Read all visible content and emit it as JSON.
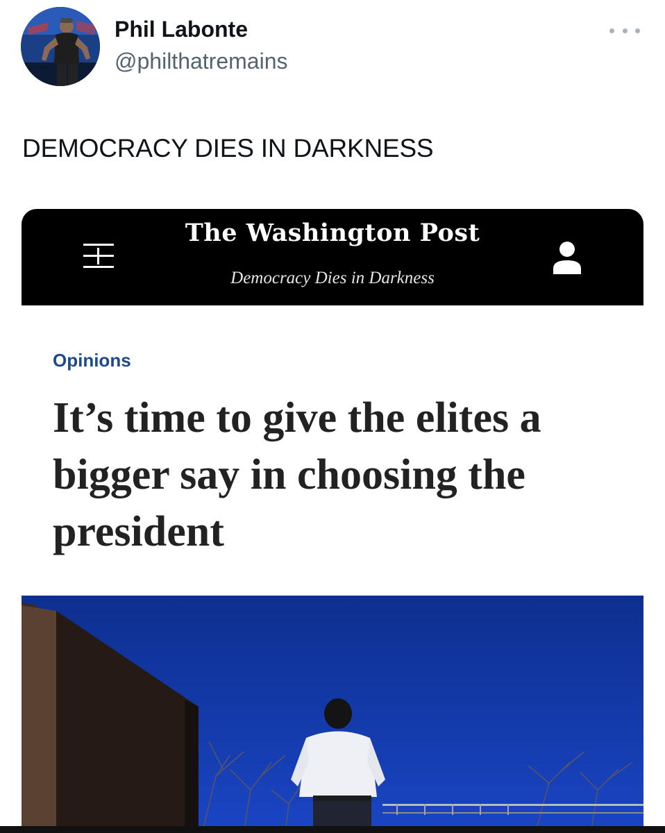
{
  "tweet": {
    "author_name": "Phil Labonte",
    "author_handle": "@philthatremains",
    "text": "DEMOCRACY DIES IN DARKNESS",
    "more_icon": "more-horizontal-icon"
  },
  "card": {
    "masthead": "The Washington Post",
    "tagline": "Democracy Dies in Darkness",
    "menu_icon": "hamburger-menu-icon",
    "account_icon": "user-account-icon",
    "section": "Opinions",
    "headline": "It’s time to give the elites a bigger say in choosing the president"
  },
  "colors": {
    "masthead_bg": "#000000",
    "section_label": "#1c4a8c",
    "sky": "#123aa6",
    "handle_text": "#536471"
  }
}
